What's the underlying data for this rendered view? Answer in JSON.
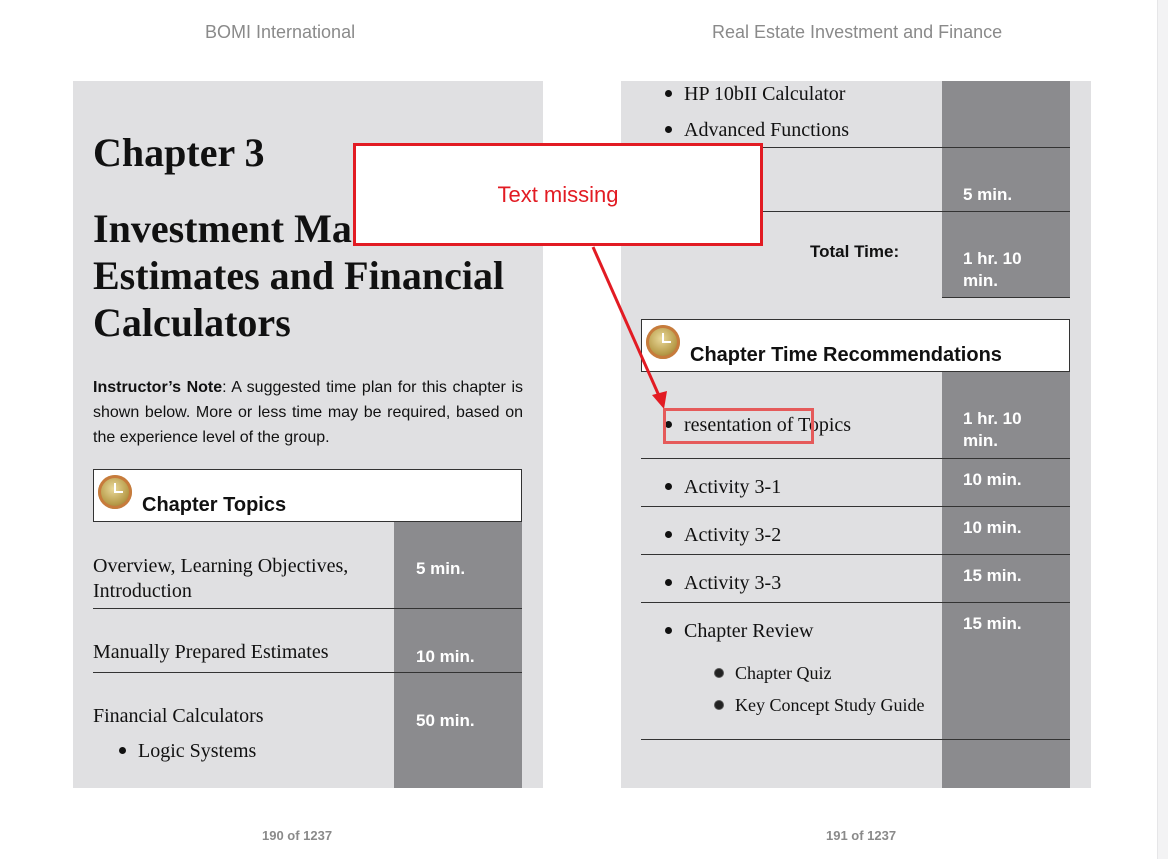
{
  "header": {
    "left": "BOMI International",
    "right": "Real Estate Investment and Finance"
  },
  "left_page": {
    "chapter": "Chapter 3",
    "title_line1": "Investment Ma",
    "title_line2": "Estimates and Financial",
    "title_line3": "Calculators",
    "note_label": "Instructor’s Note",
    "note_text": ": A suggested time plan for this chapter is shown below. More or less time may be required, based on the experience level of the group.",
    "topics_title": "Chapter Topics",
    "rows": [
      {
        "label1": "Overview, Learning Objectives,",
        "label2": "Introduction",
        "time": "5 min."
      },
      {
        "label1": "Manually Prepared Estimates",
        "time": "10 min."
      },
      {
        "label1": "Financial Calculators",
        "bullet": "Logic Systems",
        "time": "50 min."
      }
    ],
    "page_number": "190 of 1237"
  },
  "right_page": {
    "top_bullets": [
      "HP 10bII Calculator",
      "Advanced Functions"
    ],
    "row_time_1": "5 min.",
    "total_label": "Total Time:",
    "total_time_1": "1 hr. 10",
    "total_time_2": "min.",
    "recs_title": "Chapter Time Recommendations",
    "recs": [
      {
        "label": "resentation of Topics",
        "time1": "1 hr. 10",
        "time2": "min."
      },
      {
        "label": "Activity 3-1",
        "time1": "10 min."
      },
      {
        "label": "Activity 3-2",
        "time1": "10 min."
      },
      {
        "label": "Activity 3-3",
        "time1": "15 min."
      },
      {
        "label": "Chapter Review",
        "time1": "15 min."
      }
    ],
    "review_sub": [
      "Chapter Quiz",
      "Key Concept Study Guide"
    ],
    "page_number": "191 of 1237"
  },
  "annotation": {
    "callout_text": "Text missing",
    "color": "#e21b23"
  }
}
